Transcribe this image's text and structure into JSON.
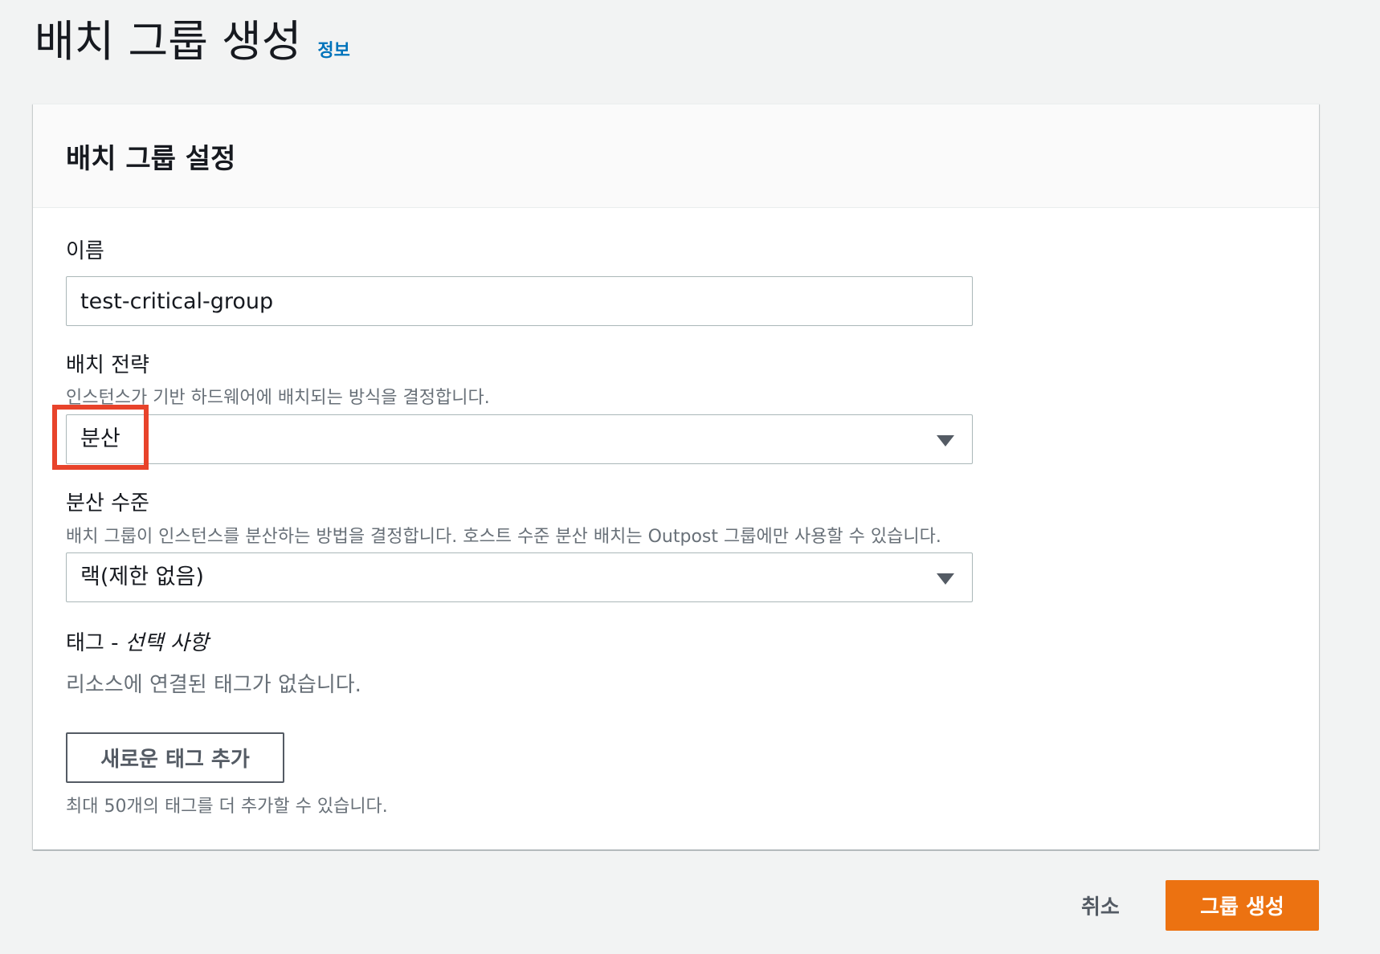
{
  "page": {
    "title": "배치 그룹 생성",
    "info_link": "정보"
  },
  "panel": {
    "title": "배치 그룹 설정"
  },
  "name_field": {
    "label": "이름",
    "value": "test-critical-group"
  },
  "strategy_field": {
    "label": "배치 전략",
    "description": "인스턴스가 기반 하드웨어에 배치되는 방식을 결정합니다.",
    "selected": "분산"
  },
  "spread_level_field": {
    "label": "분산 수준",
    "description": "배치 그룹이 인스턴스를 분산하는 방법을 결정합니다. 호스트 수준 분산 배치는 Outpost 그룹에만 사용할 수 있습니다.",
    "selected": "랙(제한 없음)"
  },
  "tags": {
    "label": "태그 - ",
    "optional": "선택 사항",
    "empty_text": "리소스에 연결된 태그가 없습니다.",
    "add_button": "새로운 태그 추가",
    "limit_text": "최대 50개의 태그를 더 추가할 수 있습니다."
  },
  "footer": {
    "cancel": "취소",
    "create": "그룹 생성"
  },
  "colors": {
    "primary": "#ec7211",
    "link": "#0073bb",
    "highlight": "#e8432b"
  },
  "icons": {
    "dropdown": "caret-down-icon"
  }
}
